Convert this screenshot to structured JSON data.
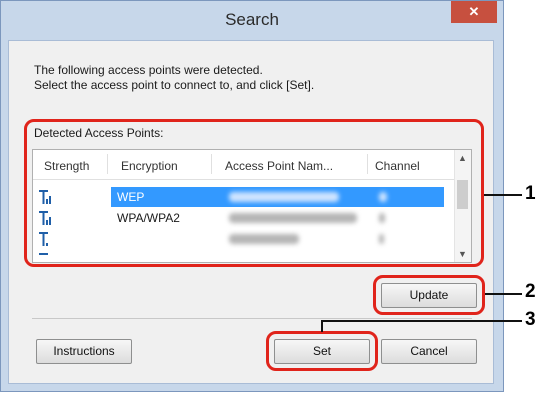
{
  "window": {
    "title": "Search",
    "close_glyph": "✕"
  },
  "description": {
    "line1": "The following access points were detected.",
    "line2": "Select the access point to connect to, and click [Set]."
  },
  "detected_label": "Detected Access Points:",
  "table": {
    "columns": [
      "Strength",
      "Encryption",
      "Access Point Nam...",
      "Channel"
    ],
    "rows": [
      {
        "encryption": "WEP",
        "selected": true,
        "signal_bars": 3
      },
      {
        "encryption": "WPA/WPA2",
        "selected": false,
        "signal_bars": 3
      },
      {
        "encryption": "",
        "selected": false,
        "signal_bars": 1
      }
    ]
  },
  "buttons": {
    "update": "Update",
    "instructions": "Instructions",
    "set": "Set",
    "cancel": "Cancel"
  },
  "callouts": [
    "1",
    "2",
    "3"
  ],
  "colors": {
    "accent": "#e0241b",
    "selection": "#3399ff",
    "signal": "#1f5fa8",
    "close": "#c7503f"
  }
}
